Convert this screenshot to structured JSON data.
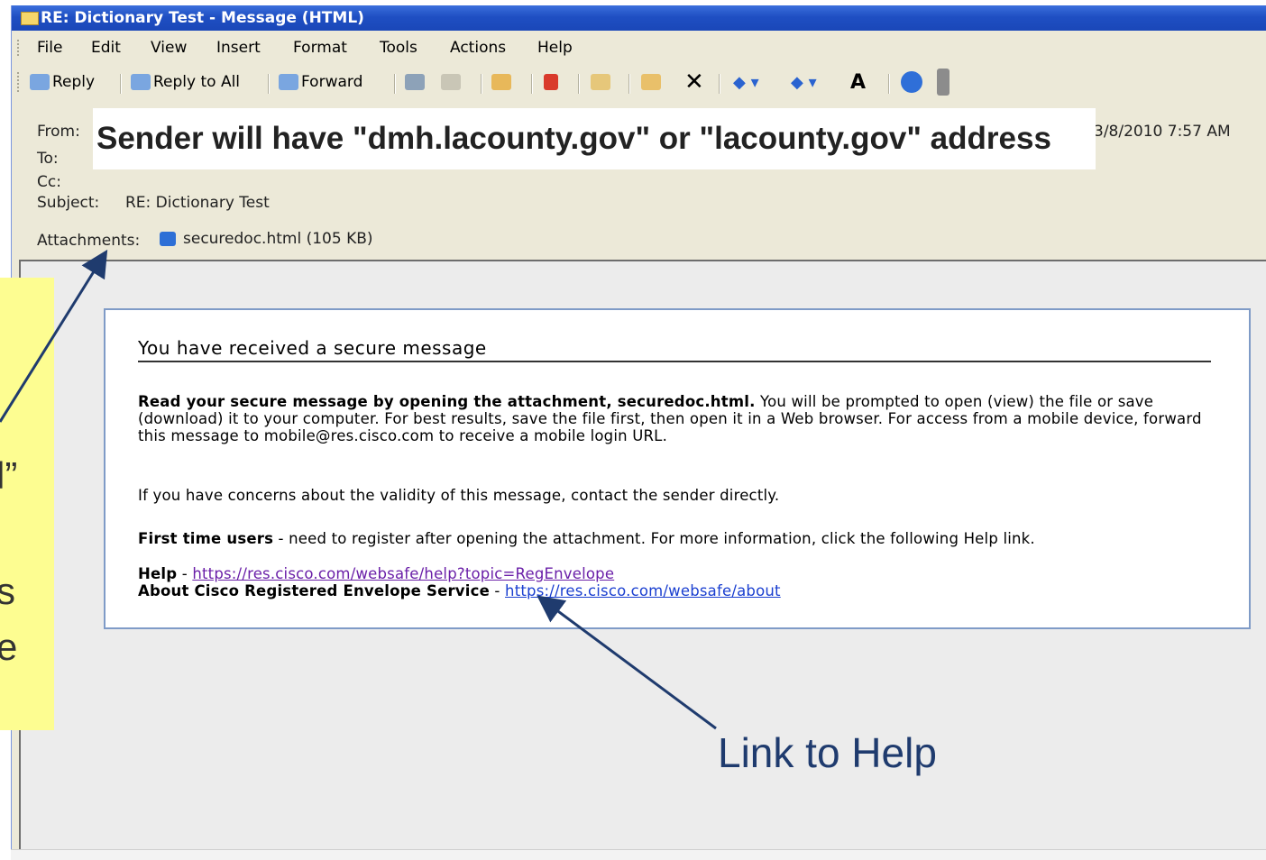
{
  "window": {
    "title": "RE: Dictionary Test - Message (HTML)"
  },
  "menu": [
    "File",
    "Edit",
    "View",
    "Insert",
    "Format",
    "Tools",
    "Actions",
    "Help"
  ],
  "toolbar": {
    "reply": "Reply",
    "reply_all": "Reply to All",
    "forward": "Forward",
    "icons": [
      "print-icon",
      "copy-icon",
      "move-to-folder-icon",
      "flag-icon",
      "open-envelope-icon",
      "forward-item-icon",
      "delete-icon",
      "previous-item-icon",
      "next-item-icon",
      "font-size-icon",
      "help-icon"
    ]
  },
  "header": {
    "from_label": "From:",
    "to_label": "To:",
    "cc_label": "Cc:",
    "subject_label": "Subject:",
    "subject": "RE: Dictionary Test",
    "sent": "3/8/2010 7:57 AM",
    "attachments_label": "Attachments:",
    "attachment": "securedoc.html (105 KB)"
  },
  "annotations": {
    "sender_note": "Sender will have \"dmh.lacounty.gov\" or \"lacounty.gov\" address",
    "help_note": "Link to Help",
    "side_fragments": [
      "l”",
      "",
      "s",
      "e"
    ]
  },
  "message": {
    "title": "You have received a secure message",
    "p1_bold": "Read your secure message by opening the attachment, securedoc.html.",
    "p1_rest": " You will be prompted to open (view) the file or save (download) it to your computer. For best results, save the file first, then open it in a Web browser. For access from a mobile device, forward this message to mobile@res.cisco.com to receive a mobile login URL.",
    "p2": "If you have concerns about the validity of this message, contact the sender directly.",
    "p3_bold": "First time users",
    "p3_rest": " - need to register after opening the attachment. For more information, click the following Help link.",
    "help_label": "Help",
    "help_sep": " - ",
    "help_url": "https://res.cisco.com/websafe/help?topic=RegEnvelope",
    "about_label": "About Cisco Registered Envelope Service",
    "about_sep": " - ",
    "about_url": "https://res.cisco.com/websafe/about"
  },
  "colors": {
    "title_bar": "#1f4fc3",
    "chrome": "#ece9d8",
    "callout": "#fdfd91",
    "arrow": "#1f3b6e",
    "visited_link": "#6a1fa8",
    "link": "#1a3fd0"
  }
}
